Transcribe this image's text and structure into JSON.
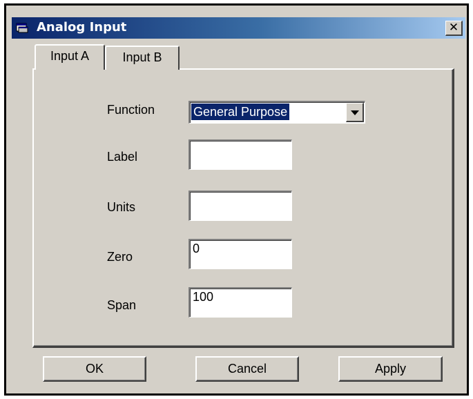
{
  "window": {
    "title": "Analog Input",
    "close_label": "✕"
  },
  "tabs": [
    {
      "label": "Input A",
      "selected": true
    },
    {
      "label": "Input B",
      "selected": false
    }
  ],
  "form": {
    "function": {
      "label": "Function",
      "value": "General Purpose"
    },
    "label_field": {
      "label": "Label",
      "value": ""
    },
    "units": {
      "label": "Units",
      "value": ""
    },
    "zero": {
      "label": "Zero",
      "value": "0"
    },
    "span": {
      "label": "Span",
      "value": "100"
    }
  },
  "buttons": {
    "ok": "OK",
    "cancel": "Cancel",
    "apply": "Apply"
  },
  "colors": {
    "titlebar_start": "#0a246a",
    "titlebar_end": "#a6caf0",
    "face": "#d4d0c8",
    "selection": "#0a246a"
  },
  "icons": {
    "app": "window-app-icon",
    "close": "close-icon",
    "dropdown": "chevron-down-icon"
  }
}
